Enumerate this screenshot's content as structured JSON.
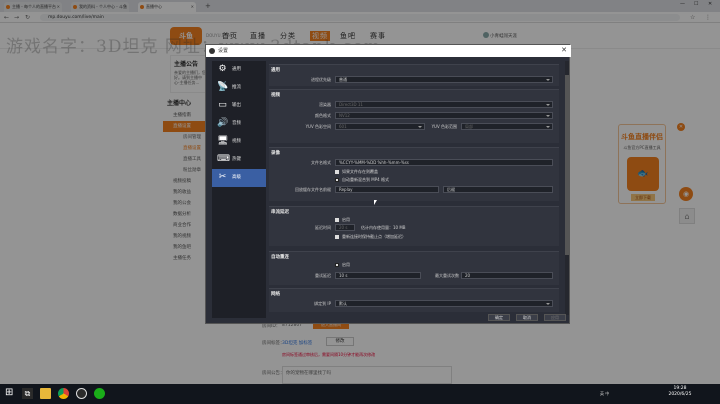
{
  "browser": {
    "tabs": [
      {
        "title": "主播 - 每个人的直播平台"
      },
      {
        "title": "我的资料 - 个人中心 - 斗鱼"
      },
      {
        "title": "直播中心"
      }
    ],
    "url": "mp.douyu.com/live/main"
  },
  "site": {
    "logo": "斗鱼",
    "logo_sub": "DOUYU.COM",
    "nav": [
      "首页",
      "直播",
      "分类",
      "视频",
      "鱼吧",
      "赛事"
    ],
    "user": "小青蛙闯天涯"
  },
  "watermark": "游戏名字：3D坦克 网址：www.3dtank.com",
  "announcement": {
    "title": "主播公告",
    "text": "亲爱的主播们，您好。请到主播中心-主播任务..."
  },
  "sidebar": {
    "header": "主播中心",
    "items": [
      {
        "label": "主播指南"
      },
      {
        "label": "直播设置",
        "active": true
      },
      {
        "label": "房间管理",
        "sub": true
      },
      {
        "label": "直播设置",
        "sub": true,
        "subactive": true
      },
      {
        "label": "直播工具",
        "sub": true
      },
      {
        "label": "粉丝勋章",
        "sub": true
      },
      {
        "label": "视频投稿"
      },
      {
        "label": "我的收益"
      },
      {
        "label": "我的公会"
      },
      {
        "label": "数据分析"
      },
      {
        "label": "商业合作"
      },
      {
        "label": "我的视频"
      },
      {
        "label": "我的鱼吧"
      },
      {
        "label": "主播任务"
      }
    ]
  },
  "room": {
    "id_label": "房间ID：",
    "id_value": "8712807",
    "enter_button": "进入直播间",
    "tag_label": "房间标签：",
    "tag_value": "3D坦克 加标签",
    "tag_button": "修改",
    "tag_note": "房间标签通过审核后，需要间隔10分钟才能再次修改",
    "notice_label": "房间公告：",
    "notice_value": "你的宠物在哪里找了吗"
  },
  "promo": {
    "title": "斗鱼直播伴侣",
    "subtitle": "斗鱼官方PC直播工具",
    "button": "立即下载"
  },
  "dialog": {
    "title": "设置",
    "nav": [
      {
        "label": "通用",
        "icon": "gear-icon"
      },
      {
        "label": "推流",
        "icon": "broadcast-icon"
      },
      {
        "label": "输出",
        "icon": "output-icon"
      },
      {
        "label": "音频",
        "icon": "speaker-icon"
      },
      {
        "label": "视频",
        "icon": "monitor-icon"
      },
      {
        "label": "热键",
        "icon": "keyboard-icon"
      },
      {
        "label": "高级",
        "icon": "tools-icon",
        "active": true
      }
    ],
    "general": {
      "title": "通用",
      "process_priority_label": "进程优先级",
      "process_priority_value": "普通"
    },
    "video": {
      "title": "视频",
      "renderer_label": "渲染器",
      "renderer_value": "Direct3D 11",
      "color_format_label": "颜色格式",
      "color_format_value": "NV12",
      "color_space_label": "YUV 色彩空间",
      "color_space_value": "601",
      "color_range_label": "YUV 色彩范围",
      "color_range_value": "局部"
    },
    "recording": {
      "title": "录像",
      "filename_format_label": "文件名格式",
      "filename_format_value": "%CCYY-%MM-%DD %hh-%mm-%ss",
      "overwrite_label": "如果文件存在则覆盖",
      "remux_label": "自动重新混合到 MP4 格式",
      "replay_label": "回放缓存文件名前缀",
      "replay_value": "Replay",
      "suffix_label": "后缀"
    },
    "stream_delay": {
      "title": "串流延迟",
      "enable_label": "启用",
      "duration_label": "延迟时间",
      "duration_value": "20 s",
      "estimate": "估计内存使用量：10 MB",
      "preserve_label": "重新连接时保持截止点（增加延迟）"
    },
    "reconnect": {
      "title": "自动重连",
      "enable_label": "启用",
      "retry_delay_label": "重试延迟",
      "retry_delay_value": "10 s",
      "max_retries_label": "最大重试次数",
      "max_retries_value": "20"
    },
    "network": {
      "title": "网络",
      "bind_ip_label": "绑定到 IP",
      "bind_ip_value": "默认"
    },
    "buttons": {
      "ok": "确定",
      "cancel": "取消",
      "apply": "应用"
    }
  },
  "taskbar": {
    "tray": "英 中",
    "time": "19:28",
    "date": "2020/6/25"
  }
}
